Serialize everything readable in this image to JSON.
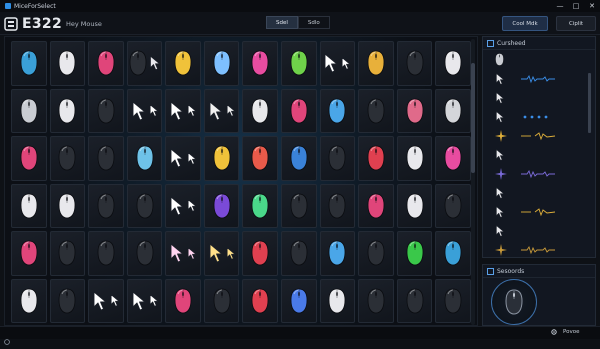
{
  "window": {
    "title": "MiceForSelect",
    "minimize_glyph": "—",
    "maximize_glyph": "□",
    "close_glyph": "✕"
  },
  "toolbar": {
    "brand": "E322",
    "subtitle": "Hey Mouse",
    "segments": [
      "Sdel",
      "Sdlo"
    ],
    "active_segment": 0,
    "primary_button": "Cool Mdk",
    "secondary_button": "Ciplit"
  },
  "grid": {
    "rows": [
      [
        "mouse:#3aa0d8",
        "mouse:#e8e8ec",
        "mouse:#e0457a",
        "pair:#2b2f36",
        "mouse:#f0c23a",
        "mouse:#7ec0ff",
        "mouse:#e84ca0",
        "mouse:#6fd24a",
        "cursor:#ffffff",
        "mouse:#e8b03a",
        "mouse:#2b2f36",
        "mouse:#e8e8ec"
      ],
      [
        "mouse:#c9ccd2",
        "mouse:#e8e8ec",
        "mouse:#2b2f36",
        "cursor:#ffffff",
        "cursor:#ffffff",
        "cursor:#f0f0f0",
        "mouse:#e8e8ec",
        "mouse:#e0457a",
        "mouse:#4aa6e8",
        "mouse:#2b2f36",
        "mouse:#e06a8a",
        "mouse:#d4d6da"
      ],
      [
        "mouse:#e0457a",
        "mouse:#2b2f36",
        "mouse:#2b2f36",
        "mouse:#6ec2e8",
        "cursor:#ffffff",
        "mouse:#f0c23a",
        "mouse:#e85a4a",
        "mouse:#3a82d8",
        "mouse:#2b2f36",
        "mouse:#e04050",
        "mouse:#e8e8ec",
        "mouse:#e84ca0"
      ],
      [
        "mouse:#e8e8ec",
        "mouse:#e8e8ec",
        "mouse:#2b2f36",
        "mouse:#2b2f36",
        "cursor:#ffffff",
        "mouse:#7a4ad8",
        "mouse:#4ad88a",
        "mouse:#2b2f36",
        "mouse:#2b2f36",
        "mouse:#e0457a",
        "mouse:#e8e8ec",
        "mouse:#2b2f36"
      ],
      [
        "mouse:#e0457a",
        "mouse:#2b2f36",
        "mouse:#2b2f36",
        "mouse:#2b2f36",
        "cursor:#ffd4f0",
        "cursor:#ffe08a",
        "mouse:#e04050",
        "mouse:#2b2f36",
        "mouse:#4aa6e8",
        "mouse:#2b2f36",
        "mouse:#3ac84a",
        "mouse:#3aa0d8"
      ],
      [
        "mouse:#e8e8ec",
        "mouse:#2b2f36",
        "cursor:#ffffff",
        "cursor:#ffffff",
        "mouse:#e0457a",
        "mouse:#2b2f36",
        "mouse:#e04050",
        "mouse:#4a7ae8",
        "mouse:#e8e8ec",
        "mouse:#2b2f36",
        "mouse:#2b2f36",
        "mouse:#2b2f36"
      ]
    ]
  },
  "side_panel": {
    "title": "Cursheed",
    "items": [
      {
        "glyph": "mouse",
        "wave": "none",
        "color": "#9aa3b0"
      },
      {
        "glyph": "cursor",
        "wave": "line",
        "color": "#3a8ee8"
      },
      {
        "glyph": "cursor",
        "wave": "none",
        "color": "#3a8ee8"
      },
      {
        "glyph": "cursor",
        "wave": "dots",
        "color": "#3a8ee8"
      },
      {
        "glyph": "spark",
        "wave": "spark",
        "color": "#e0b03a"
      },
      {
        "glyph": "cursor",
        "wave": "none",
        "color": "#e0b03a"
      },
      {
        "glyph": "spark",
        "wave": "line",
        "color": "#7a6ad8"
      },
      {
        "glyph": "cursor",
        "wave": "none",
        "color": "#e0b03a"
      },
      {
        "glyph": "cursor",
        "wave": "spark",
        "color": "#e0b03a"
      },
      {
        "glyph": "cursor",
        "wave": "none",
        "color": "#e0b03a"
      },
      {
        "glyph": "spark",
        "wave": "line",
        "color": "#c89a3a"
      }
    ]
  },
  "scanner": {
    "title": "Sesoords"
  },
  "statusbar": {
    "right_label": "Povoe"
  }
}
